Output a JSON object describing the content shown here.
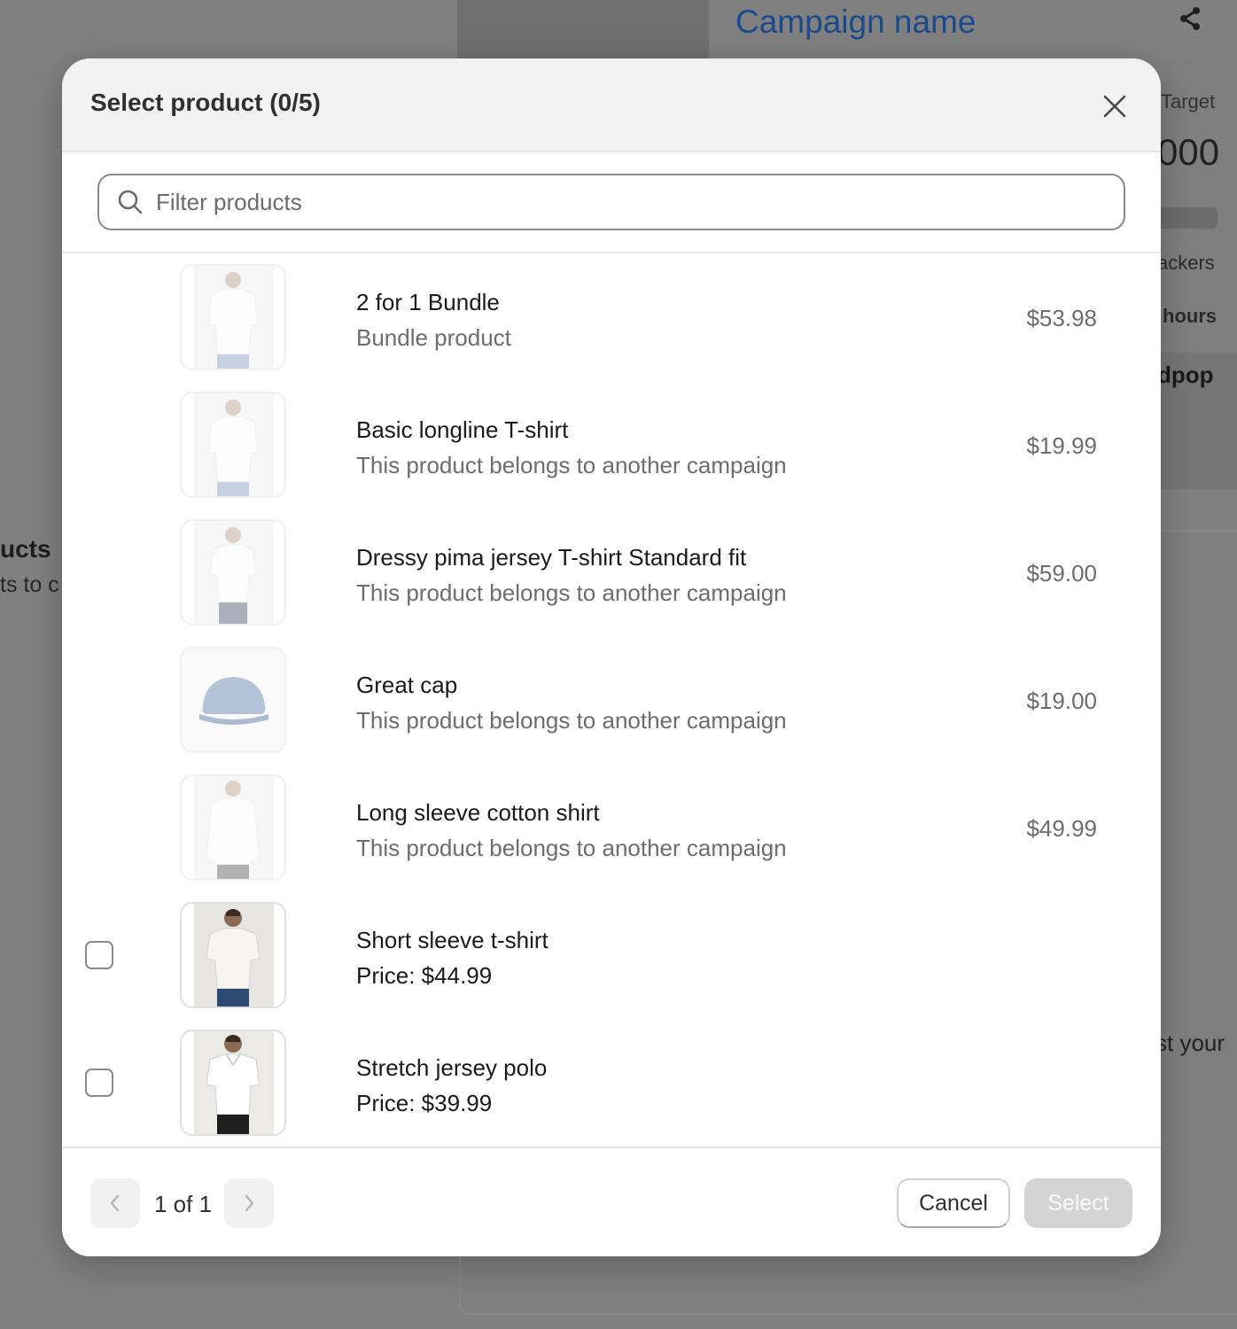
{
  "background": {
    "campaign_title": "Campaign name",
    "target_label": "Target",
    "target_value": "000",
    "backers_label": "ackers",
    "hours_label": "hours",
    "brand_text": "dpop",
    "left_heading": "ucts",
    "left_subtext": "ts to c",
    "right_text": "st your"
  },
  "modal": {
    "title": "Select product (0/5)",
    "search_placeholder": "Filter products",
    "products": [
      {
        "name": "2 for 1 Bundle",
        "subtitle": "Bundle product",
        "price": "$53.98",
        "selectable": false,
        "image": "tshirt-white"
      },
      {
        "name": "Basic longline T-shirt",
        "subtitle": "This product belongs to another campaign",
        "price": "$19.99",
        "selectable": false,
        "image": "tshirt-white"
      },
      {
        "name": "Dressy pima jersey T-shirt Standard fit",
        "subtitle": "This product belongs to another campaign",
        "price": "$59.00",
        "selectable": false,
        "image": "tshirt-white"
      },
      {
        "name": "Great cap",
        "subtitle": "This product belongs to another campaign",
        "price": "$19.00",
        "selectable": false,
        "image": "cap"
      },
      {
        "name": "Long sleeve cotton shirt",
        "subtitle": "This product belongs to another campaign",
        "price": "$49.99",
        "selectable": false,
        "image": "longsleeve"
      },
      {
        "name": "Short sleeve t-shirt",
        "subtitle": "Price: $44.99",
        "price": "",
        "selectable": true,
        "image": "tshirt-model"
      },
      {
        "name": "Stretch jersey polo",
        "subtitle": "Price: $39.99",
        "price": "",
        "selectable": true,
        "image": "polo-model"
      }
    ],
    "pagination_label": "1 of 1",
    "cancel_label": "Cancel",
    "select_label": "Select"
  }
}
